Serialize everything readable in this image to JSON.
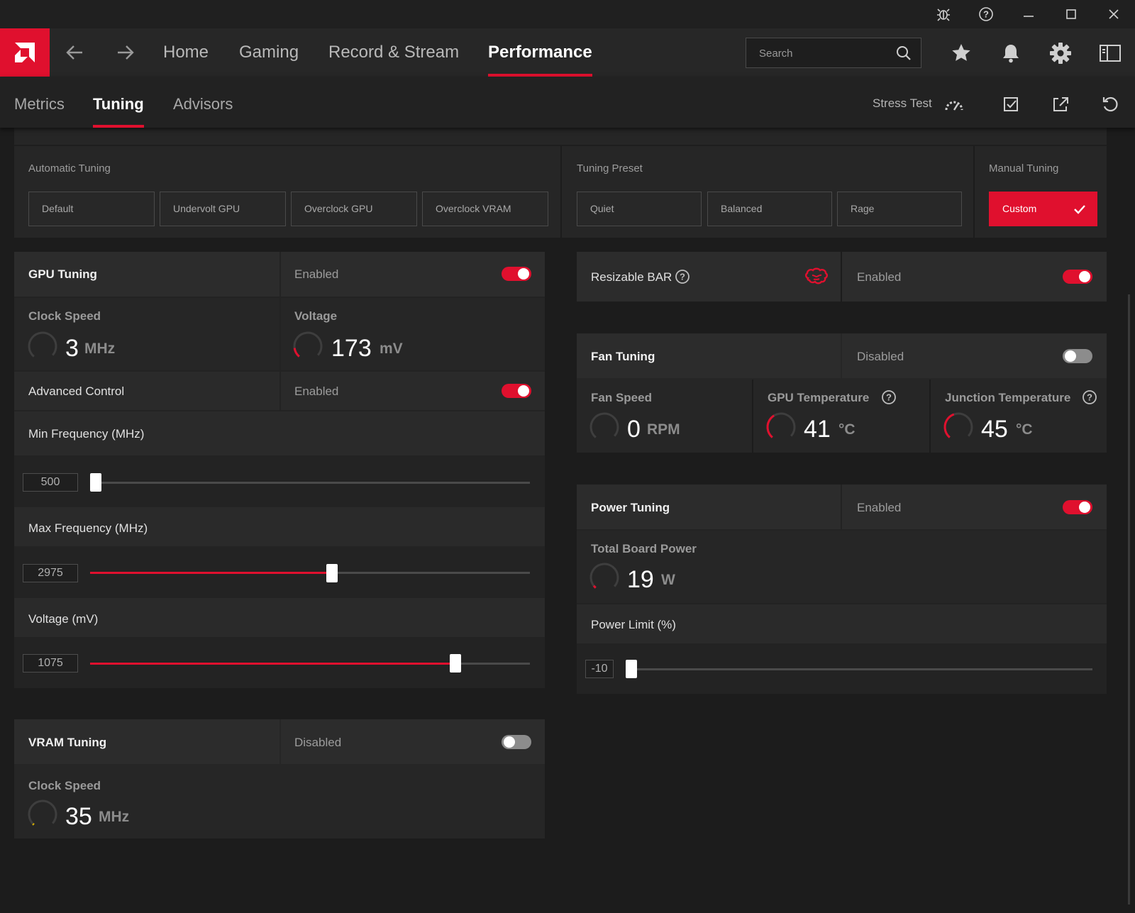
{
  "nav": {
    "tabs": [
      "Home",
      "Gaming",
      "Record & Stream",
      "Performance"
    ],
    "active_tab": "Performance",
    "search_placeholder": "Search"
  },
  "subnav": {
    "tabs": [
      "Metrics",
      "Tuning",
      "Advisors"
    ],
    "active_tab": "Tuning",
    "stress_test_label": "Stress Test"
  },
  "tuning_control": {
    "automatic": {
      "label": "Automatic Tuning",
      "buttons": [
        "Default",
        "Undervolt GPU",
        "Overclock GPU",
        "Overclock VRAM"
      ]
    },
    "preset": {
      "label": "Tuning Preset",
      "buttons": [
        "Quiet",
        "Balanced",
        "Rage"
      ]
    },
    "manual": {
      "label": "Manual Tuning",
      "button": "Custom"
    }
  },
  "gpu_tuning": {
    "title": "GPU Tuning",
    "state": "Enabled",
    "enabled": true,
    "clock_speed": {
      "label": "Clock Speed",
      "value": "3",
      "unit": "MHz"
    },
    "voltage": {
      "label": "Voltage",
      "value": "173",
      "unit": "mV"
    },
    "advanced_control": {
      "label": "Advanced Control",
      "state": "Enabled",
      "enabled": true
    },
    "min_frequency": {
      "label": "Min Frequency (MHz)",
      "value": "500",
      "fraction": 0.0
    },
    "max_frequency": {
      "label": "Max Frequency (MHz)",
      "value": "2975",
      "fraction": 0.55
    },
    "voltage_mv": {
      "label": "Voltage (mV)",
      "value": "1075",
      "fraction": 0.83
    }
  },
  "vram_tuning": {
    "title": "VRAM Tuning",
    "state": "Disabled",
    "enabled": false,
    "clock_speed": {
      "label": "Clock Speed",
      "value": "35",
      "unit": "MHz"
    }
  },
  "resizable_bar": {
    "label": "Resizable BAR",
    "state": "Enabled",
    "enabled": true
  },
  "fan_tuning": {
    "title": "Fan Tuning",
    "state": "Disabled",
    "enabled": false,
    "fan_speed": {
      "label": "Fan Speed",
      "value": "0",
      "unit": "RPM"
    },
    "gpu_temperature": {
      "label": "GPU Temperature",
      "value": "41",
      "unit": "°C"
    },
    "junction_temperature": {
      "label": "Junction Temperature",
      "value": "45",
      "unit": "°C"
    }
  },
  "power_tuning": {
    "title": "Power Tuning",
    "state": "Enabled",
    "enabled": true,
    "total_board_power": {
      "label": "Total Board Power",
      "value": "19",
      "unit": "W"
    },
    "power_limit": {
      "label": "Power Limit (%)",
      "value": "-10",
      "fraction": 0.0
    }
  },
  "colors": {
    "accent": "#e0102e",
    "panel": "#262626",
    "background": "#1c1c1c"
  }
}
